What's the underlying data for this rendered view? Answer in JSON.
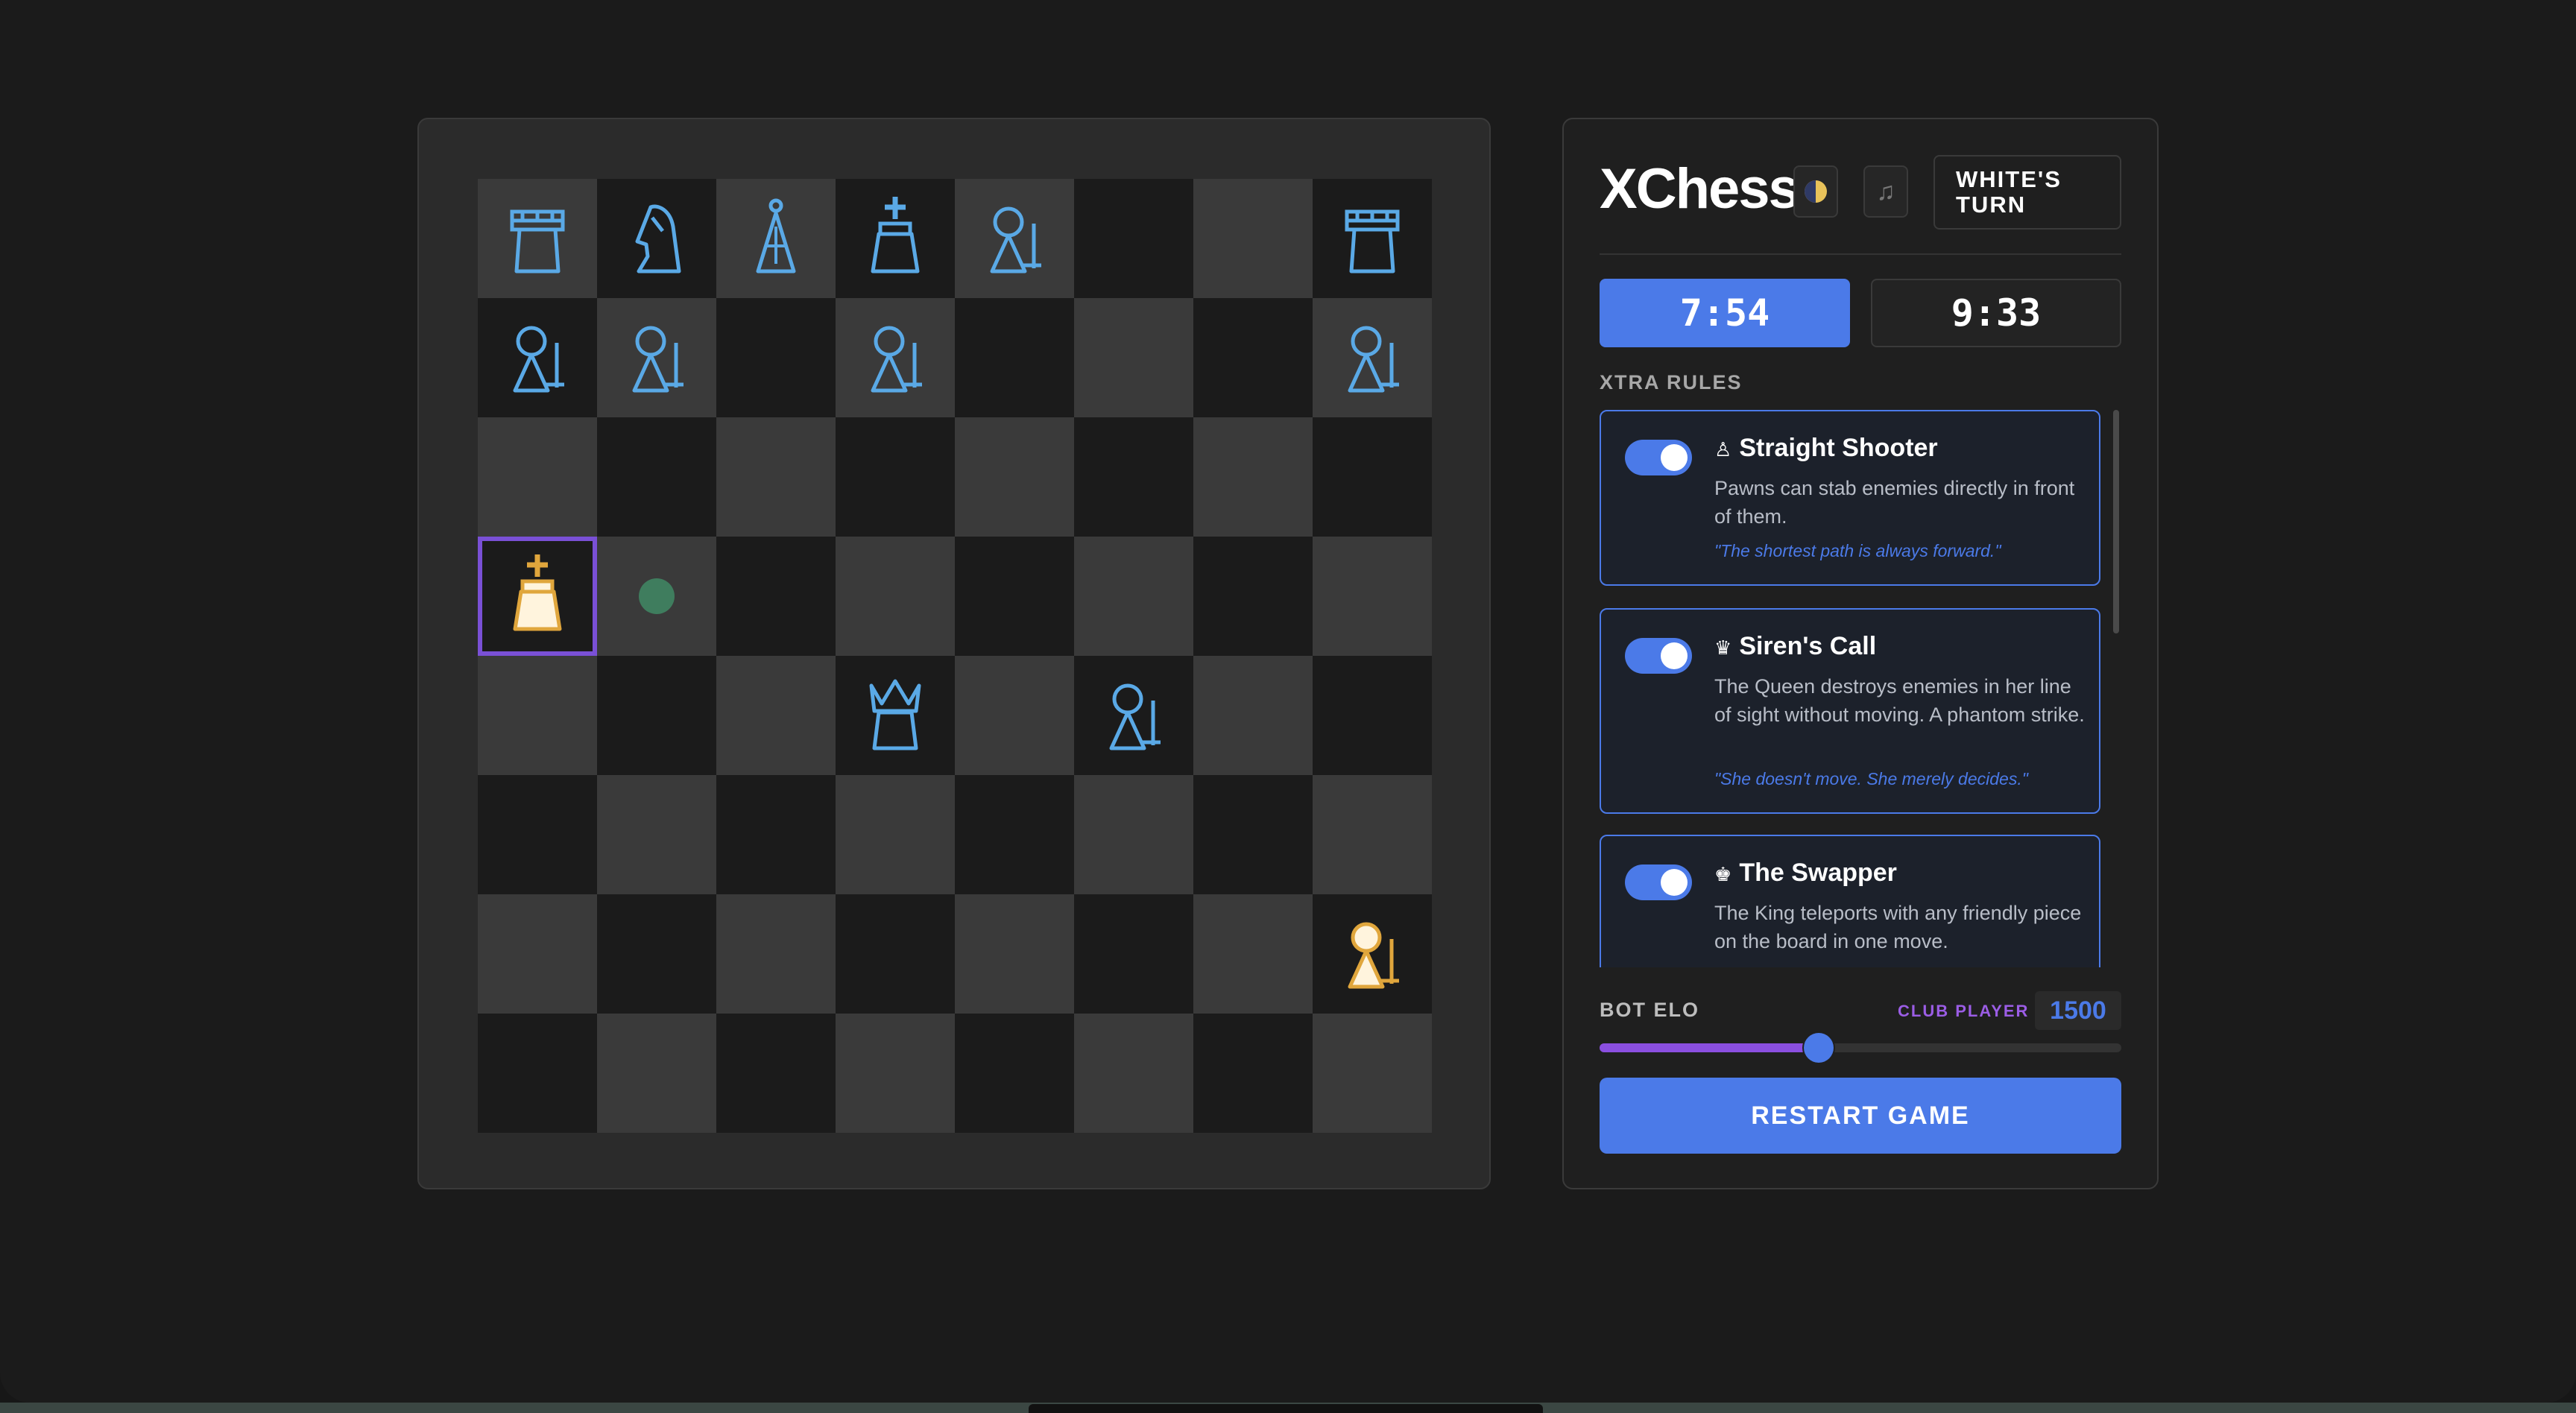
{
  "header": {
    "title": "XChess",
    "theme_icon": "half-moon-icon",
    "music_icon": "music-note-icon",
    "turn_label": "WHITE'S TURN"
  },
  "clocks": {
    "white": "7:54",
    "black": "9:33"
  },
  "rules": {
    "section_label": "XTRA RULES",
    "items": [
      {
        "glyph": "♙",
        "title": "Straight Shooter",
        "desc": "Pawns can stab enemies directly in front of them.",
        "quote": "\"The shortest path is always forward.\"",
        "enabled": true
      },
      {
        "glyph": "♛",
        "title": "Siren's Call",
        "desc": "The Queen destroys enemies in her line of sight without moving. A phantom strike.",
        "quote": "\"She doesn't move. She merely decides.\"",
        "enabled": true
      },
      {
        "glyph": "♚",
        "title": "The Swapper",
        "desc": "The King teleports with any friendly piece on the board in one move.",
        "quote": "",
        "enabled": true
      }
    ]
  },
  "elo": {
    "label": "BOT ELO",
    "tier": "CLUB PLAYER",
    "value": "1500",
    "fraction": 0.42
  },
  "restart_label": "RESTART GAME",
  "colors": {
    "accent": "#4b7ae8",
    "purple": "#8b4fe0",
    "blue_piece": "#5aa9e6",
    "gold_piece": "#e0a63c",
    "selected": "#7a50d6",
    "move_dot": "#3f7d5e"
  },
  "board": {
    "selected": [
      3,
      0
    ],
    "move_hints": [
      [
        3,
        1
      ]
    ],
    "pieces": [
      {
        "row": 0,
        "col": 0,
        "type": "rook",
        "side": "blue"
      },
      {
        "row": 0,
        "col": 1,
        "type": "knight",
        "side": "blue"
      },
      {
        "row": 0,
        "col": 2,
        "type": "bishop",
        "side": "blue"
      },
      {
        "row": 0,
        "col": 3,
        "type": "king",
        "side": "blue"
      },
      {
        "row": 0,
        "col": 4,
        "type": "pawn",
        "side": "blue"
      },
      {
        "row": 0,
        "col": 7,
        "type": "rook",
        "side": "blue"
      },
      {
        "row": 1,
        "col": 0,
        "type": "pawn",
        "side": "blue"
      },
      {
        "row": 1,
        "col": 1,
        "type": "pawn",
        "side": "blue"
      },
      {
        "row": 1,
        "col": 3,
        "type": "pawn",
        "side": "blue"
      },
      {
        "row": 1,
        "col": 7,
        "type": "pawn",
        "side": "blue"
      },
      {
        "row": 3,
        "col": 0,
        "type": "king",
        "side": "gold"
      },
      {
        "row": 4,
        "col": 3,
        "type": "queen",
        "side": "blue"
      },
      {
        "row": 4,
        "col": 5,
        "type": "pawn",
        "side": "blue"
      },
      {
        "row": 6,
        "col": 7,
        "type": "pawn",
        "side": "gold"
      }
    ]
  }
}
